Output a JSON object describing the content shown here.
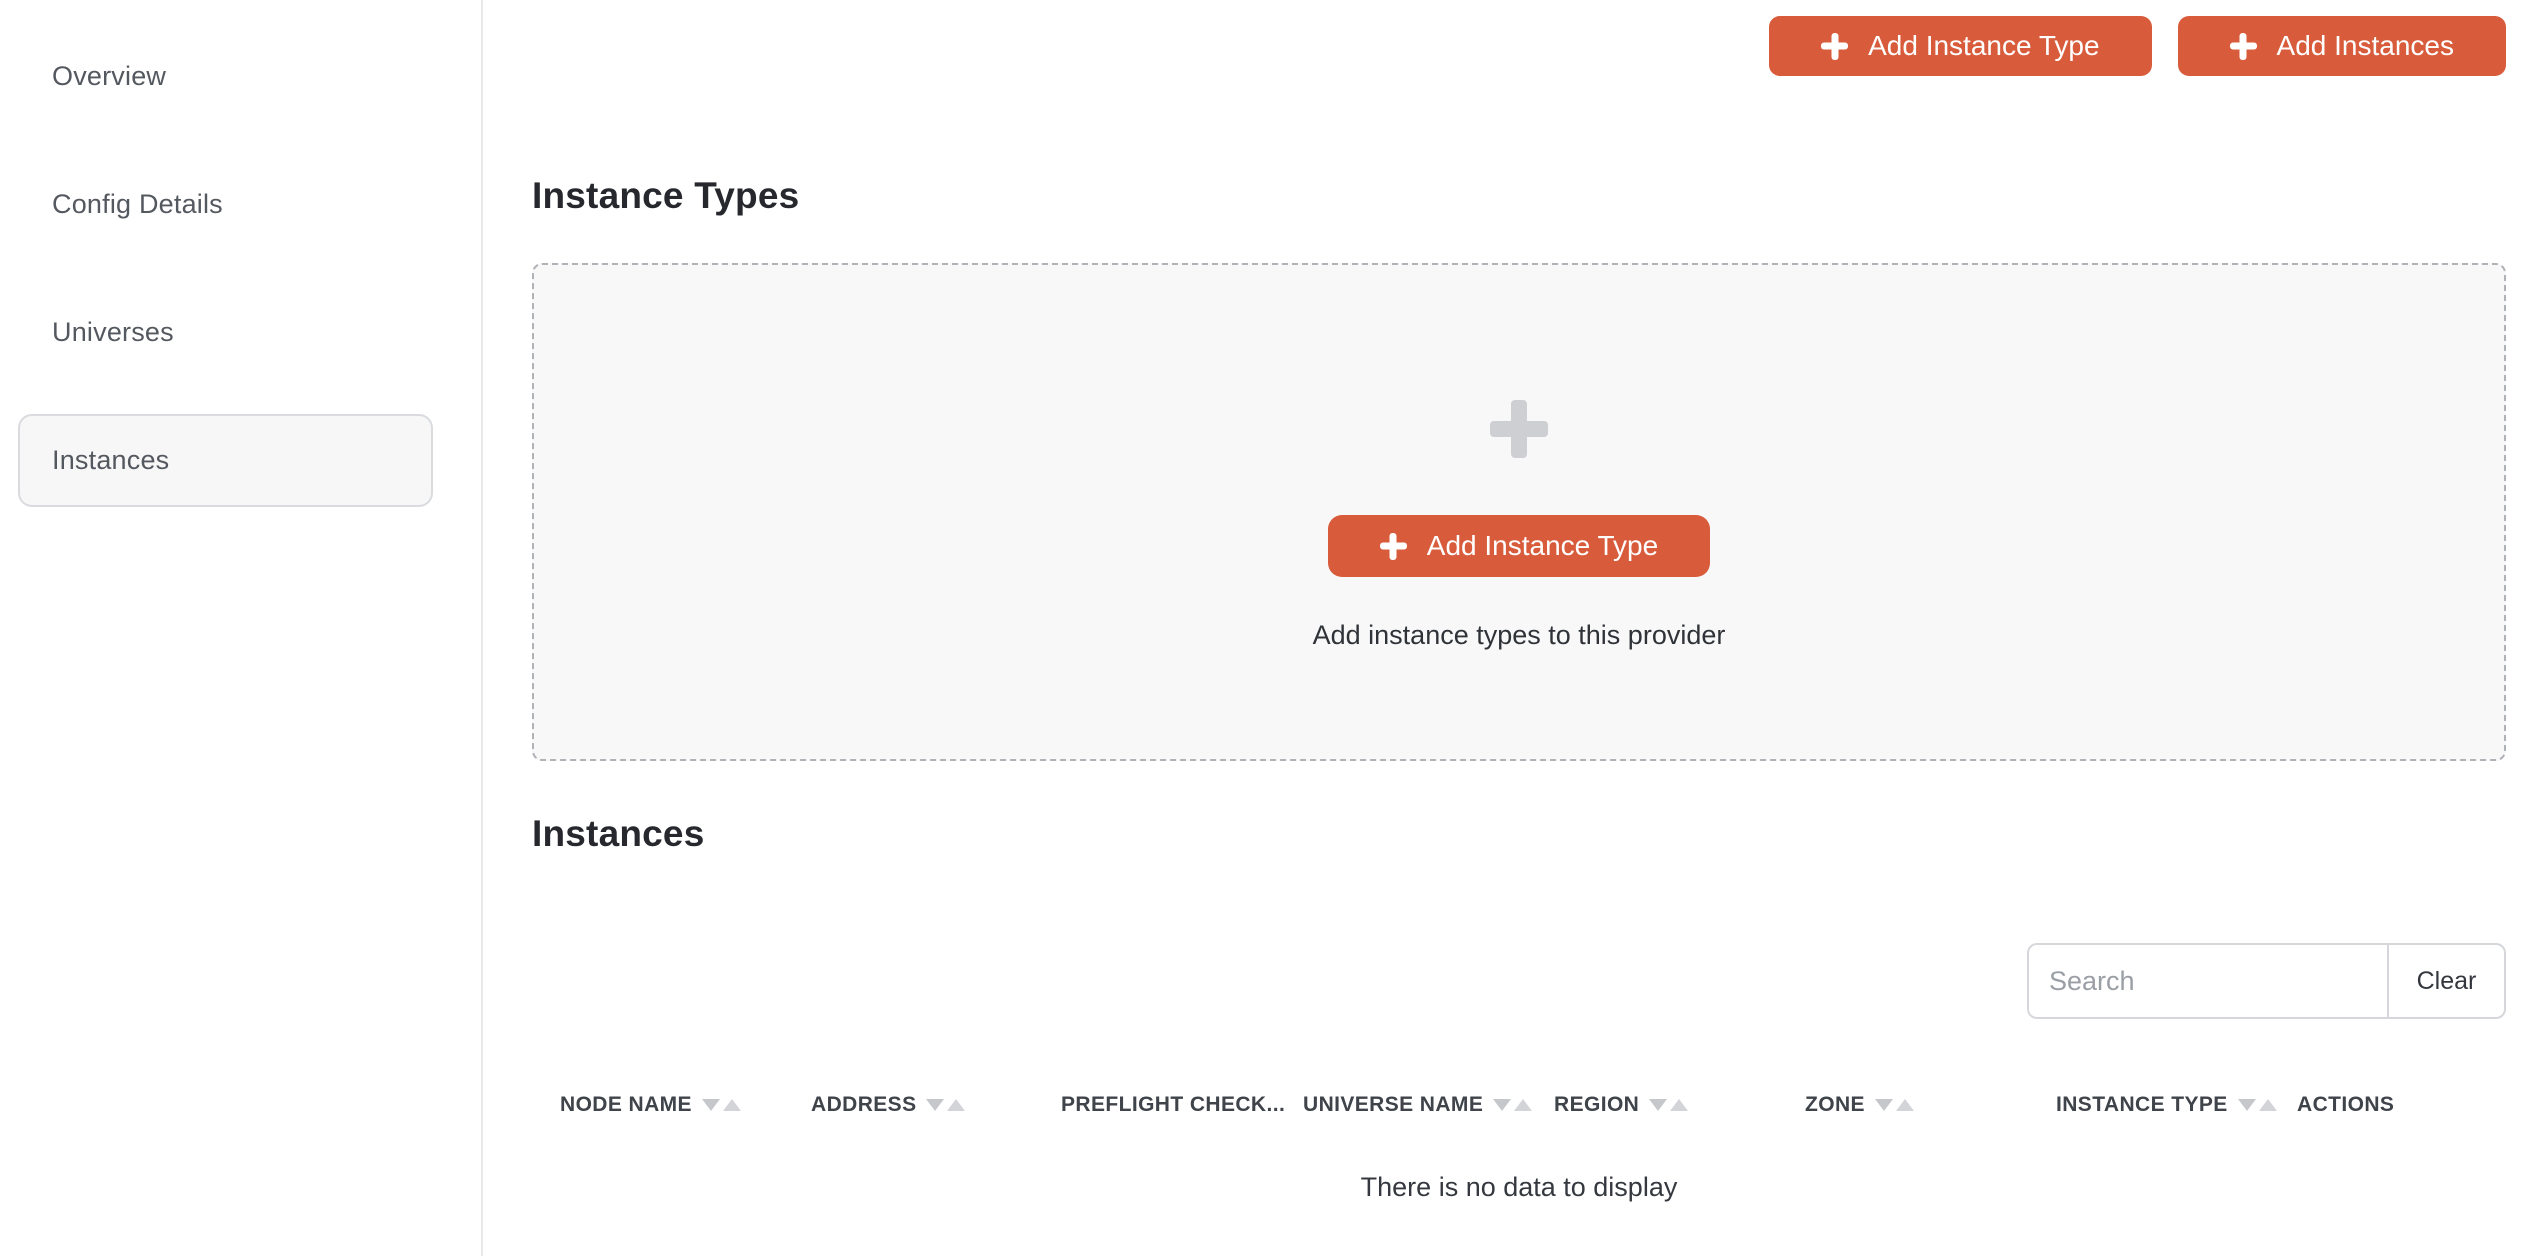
{
  "sidebar": {
    "items": [
      {
        "label": "Overview",
        "selected": false
      },
      {
        "label": "Config Details",
        "selected": false
      },
      {
        "label": "Universes",
        "selected": false
      },
      {
        "label": "Instances",
        "selected": true
      }
    ]
  },
  "header_actions": {
    "add_instance_type_label": "Add Instance Type",
    "add_instances_label": "Add Instances"
  },
  "instance_types_section": {
    "title": "Instance Types",
    "empty_state": {
      "plus_icon": "plus-icon",
      "button_label": "Add Instance Type",
      "caption": "Add instance types to this provider"
    }
  },
  "instances_section": {
    "title": "Instances",
    "search": {
      "placeholder": "Search",
      "clear_label": "Clear"
    },
    "table": {
      "columns": [
        {
          "label": "NODE NAME",
          "sortable": true
        },
        {
          "label": "ADDRESS",
          "sortable": true
        },
        {
          "label": "PREFLIGHT CHECK...",
          "sortable": false
        },
        {
          "label": "UNIVERSE NAME",
          "sortable": true
        },
        {
          "label": "REGION",
          "sortable": true
        },
        {
          "label": "ZONE",
          "sortable": true
        },
        {
          "label": "INSTANCE TYPE",
          "sortable": true
        },
        {
          "label": "ACTIONS",
          "sortable": false
        }
      ],
      "rows": [],
      "empty_message": "There is no data to display"
    }
  },
  "colors": {
    "accent": "#D85C3B",
    "panel_background": "#F8F8F9",
    "dashed_border": "#AFB2B6",
    "sidebar_selected_background": "#F7F7F8",
    "sidebar_selected_border": "#D9DBDE",
    "heading_text": "#26282E",
    "body_text": "#54585F",
    "sort_icon": "#C5C7CA"
  }
}
